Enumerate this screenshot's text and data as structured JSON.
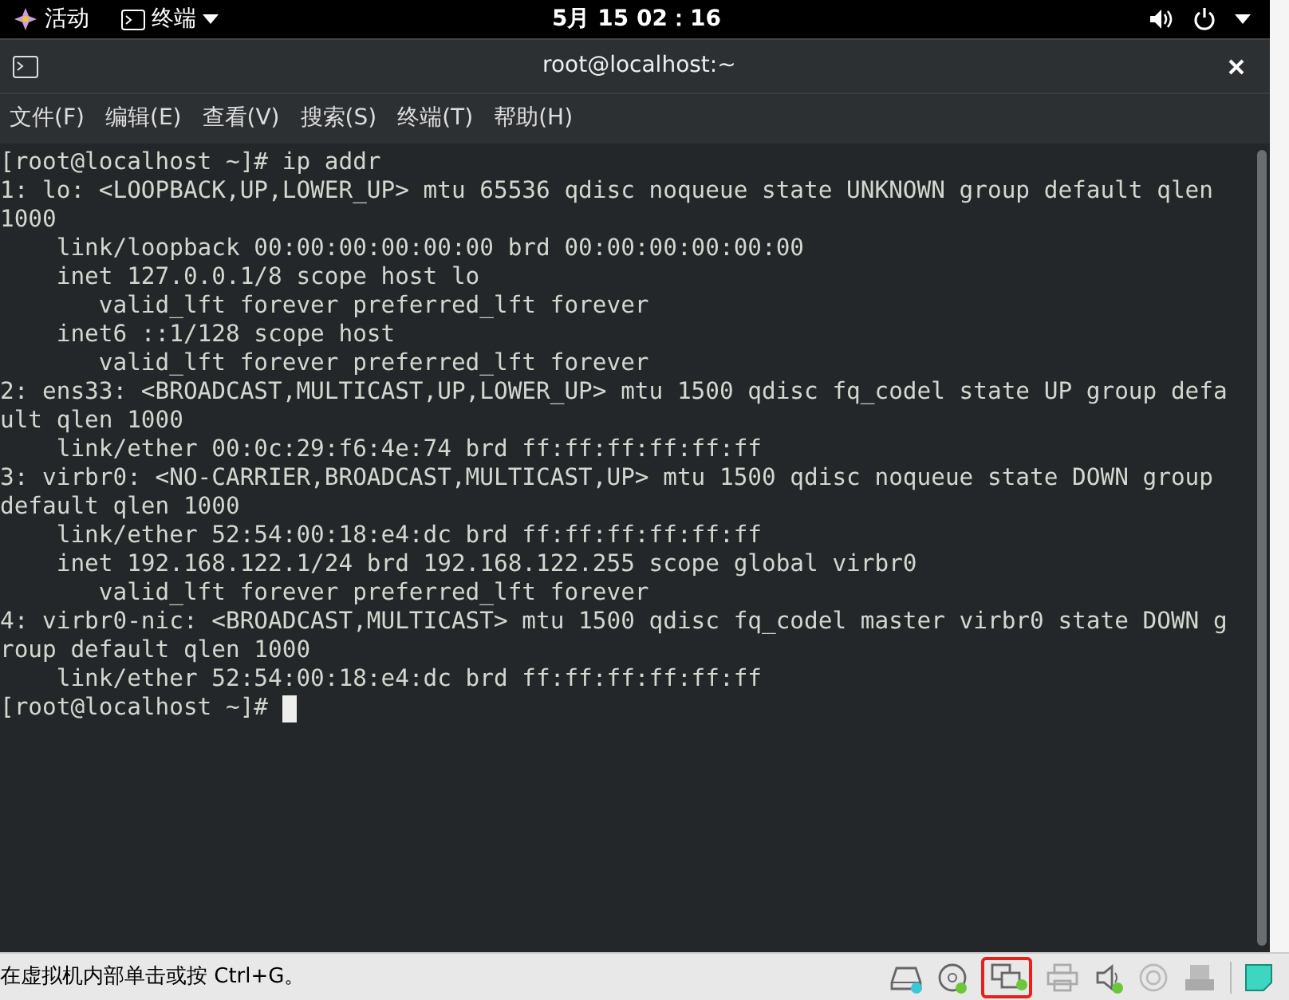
{
  "top_bar": {
    "activities": "活动",
    "app_menu": "终端",
    "clock": "5月 15 02：16"
  },
  "window": {
    "title": "root@localhost:~"
  },
  "menu": [
    "文件(F)",
    "编辑(E)",
    "查看(V)",
    "搜索(S)",
    "终端(T)",
    "帮助(H)"
  ],
  "terminal": {
    "lines": [
      "[root@localhost ~]# ip addr",
      "1: lo: <LOOPBACK,UP,LOWER_UP> mtu 65536 qdisc noqueue state UNKNOWN group default qlen",
      "1000",
      "    link/loopback 00:00:00:00:00:00 brd 00:00:00:00:00:00",
      "    inet 127.0.0.1/8 scope host lo",
      "       valid_lft forever preferred_lft forever",
      "    inet6 ::1/128 scope host",
      "       valid_lft forever preferred_lft forever",
      "2: ens33: <BROADCAST,MULTICAST,UP,LOWER_UP> mtu 1500 qdisc fq_codel state UP group defa",
      "ult qlen 1000",
      "    link/ether 00:0c:29:f6:4e:74 brd ff:ff:ff:ff:ff:ff",
      "3: virbr0: <NO-CARRIER,BROADCAST,MULTICAST,UP> mtu 1500 qdisc noqueue state DOWN group",
      "default qlen 1000",
      "    link/ether 52:54:00:18:e4:dc brd ff:ff:ff:ff:ff:ff",
      "    inet 192.168.122.1/24 brd 192.168.122.255 scope global virbr0",
      "       valid_lft forever preferred_lft forever",
      "4: virbr0-nic: <BROADCAST,MULTICAST> mtu 1500 qdisc fq_codel master virbr0 state DOWN g",
      "roup default qlen 1000",
      "    link/ether 52:54:00:18:e4:dc brd ff:ff:ff:ff:ff:ff"
    ],
    "prompt": "[root@localhost ~]# "
  },
  "status_bar": {
    "hint": "在虚拟机内部单击或按 Ctrl+G。",
    "devices": [
      {
        "kind": "disk",
        "connected": true,
        "highlighted": false
      },
      {
        "kind": "cd",
        "connected": true,
        "highlighted": false
      },
      {
        "kind": "network",
        "connected": true,
        "highlighted": true
      },
      {
        "kind": "printer",
        "connected": false,
        "highlighted": false
      },
      {
        "kind": "sound",
        "connected": true,
        "highlighted": false
      },
      {
        "kind": "camera",
        "connected": false,
        "highlighted": false
      },
      {
        "kind": "usb",
        "connected": false,
        "highlighted": false
      }
    ]
  }
}
